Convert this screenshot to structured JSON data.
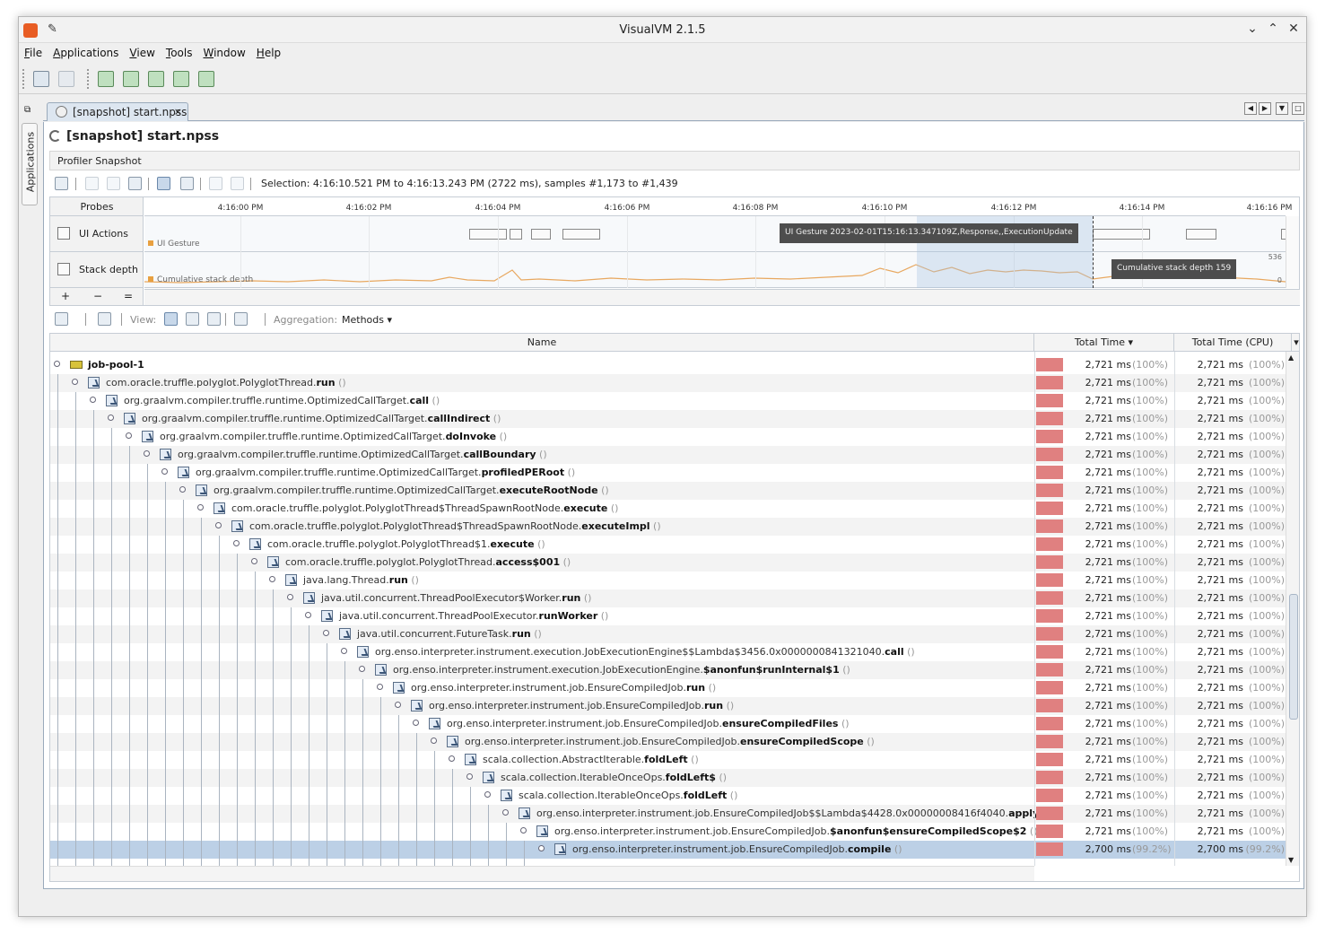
{
  "window": {
    "title": "VisualVM 2.1.5"
  },
  "menu": [
    "File",
    "Applications",
    "View",
    "Tools",
    "Window",
    "Help"
  ],
  "left_tab": "Applications",
  "doc_tab": {
    "label": "[snapshot] start.npss",
    "close": "×"
  },
  "panel": {
    "title": "[snapshot] start.npss",
    "subtab": "Profiler Snapshot"
  },
  "selection_text": "Selection: 4:16:10.521 PM to 4:16:13.243 PM (2722 ms), samples #1,173 to #1,439",
  "timeline": {
    "probes_header": "Probes",
    "rows": [
      "UI Actions",
      "Stack depth"
    ],
    "legend_ui": "UI Gesture",
    "legend_stack": "Cumulative stack depth",
    "ticks": [
      "4:16:00 PM",
      "4:16:02 PM",
      "4:16:04 PM",
      "4:16:06 PM",
      "4:16:08 PM",
      "4:16:10 PM",
      "4:16:12 PM",
      "4:16:14 PM",
      "4:16:16 PM"
    ],
    "tooltip_ui": "UI Gesture   2023-02-01T15:16:13.347109Z,Response,,ExecutionUpdate",
    "tooltip_stack": "Cumulative stack depth     159",
    "ymax": "536",
    "ymin": "0",
    "ctl": [
      "+",
      "−",
      "="
    ]
  },
  "view_toolbar": {
    "view_label": "View:",
    "aggregation_label": "Aggregation:",
    "aggregation_value": "Methods"
  },
  "columns": {
    "name": "Name",
    "total": "Total Time",
    "cpu": "Total Time (CPU)"
  },
  "rows": [
    {
      "kind": "thread",
      "pre": "",
      "bold": "job-pool-1",
      "post": "",
      "t": "2,721 ms",
      "tp": "(100%)",
      "c": "2,721 ms",
      "cp": "(100%)"
    },
    {
      "kind": "m",
      "pre": "com.oracle.truffle.polyglot.PolyglotThread.",
      "bold": "run",
      "post": " ()",
      "t": "2,721 ms",
      "tp": "(100%)",
      "c": "2,721 ms",
      "cp": "(100%)"
    },
    {
      "kind": "m",
      "pre": "org.graalvm.compiler.truffle.runtime.OptimizedCallTarget.",
      "bold": "call",
      "post": " ()",
      "t": "2,721 ms",
      "tp": "(100%)",
      "c": "2,721 ms",
      "cp": "(100%)"
    },
    {
      "kind": "m",
      "pre": "org.graalvm.compiler.truffle.runtime.OptimizedCallTarget.",
      "bold": "callIndirect",
      "post": " ()",
      "t": "2,721 ms",
      "tp": "(100%)",
      "c": "2,721 ms",
      "cp": "(100%)"
    },
    {
      "kind": "m",
      "pre": "org.graalvm.compiler.truffle.runtime.OptimizedCallTarget.",
      "bold": "doInvoke",
      "post": " ()",
      "t": "2,721 ms",
      "tp": "(100%)",
      "c": "2,721 ms",
      "cp": "(100%)"
    },
    {
      "kind": "m",
      "pre": "org.graalvm.compiler.truffle.runtime.OptimizedCallTarget.",
      "bold": "callBoundary",
      "post": " ()",
      "t": "2,721 ms",
      "tp": "(100%)",
      "c": "2,721 ms",
      "cp": "(100%)"
    },
    {
      "kind": "m",
      "pre": "org.graalvm.compiler.truffle.runtime.OptimizedCallTarget.",
      "bold": "profiledPERoot",
      "post": " ()",
      "t": "2,721 ms",
      "tp": "(100%)",
      "c": "2,721 ms",
      "cp": "(100%)"
    },
    {
      "kind": "m",
      "pre": "org.graalvm.compiler.truffle.runtime.OptimizedCallTarget.",
      "bold": "executeRootNode",
      "post": " ()",
      "t": "2,721 ms",
      "tp": "(100%)",
      "c": "2,721 ms",
      "cp": "(100%)"
    },
    {
      "kind": "m",
      "pre": "com.oracle.truffle.polyglot.PolyglotThread$ThreadSpawnRootNode.",
      "bold": "execute",
      "post": " ()",
      "t": "2,721 ms",
      "tp": "(100%)",
      "c": "2,721 ms",
      "cp": "(100%)"
    },
    {
      "kind": "m",
      "pre": "com.oracle.truffle.polyglot.PolyglotThread$ThreadSpawnRootNode.",
      "bold": "executeImpl",
      "post": " ()",
      "t": "2,721 ms",
      "tp": "(100%)",
      "c": "2,721 ms",
      "cp": "(100%)"
    },
    {
      "kind": "m",
      "pre": "com.oracle.truffle.polyglot.PolyglotThread$1.",
      "bold": "execute",
      "post": " ()",
      "t": "2,721 ms",
      "tp": "(100%)",
      "c": "2,721 ms",
      "cp": "(100%)"
    },
    {
      "kind": "m",
      "pre": "com.oracle.truffle.polyglot.PolyglotThread.",
      "bold": "access$001",
      "post": " ()",
      "t": "2,721 ms",
      "tp": "(100%)",
      "c": "2,721 ms",
      "cp": "(100%)"
    },
    {
      "kind": "m",
      "pre": "java.lang.Thread.",
      "bold": "run",
      "post": " ()",
      "t": "2,721 ms",
      "tp": "(100%)",
      "c": "2,721 ms",
      "cp": "(100%)"
    },
    {
      "kind": "m",
      "pre": "java.util.concurrent.ThreadPoolExecutor$Worker.",
      "bold": "run",
      "post": " ()",
      "t": "2,721 ms",
      "tp": "(100%)",
      "c": "2,721 ms",
      "cp": "(100%)"
    },
    {
      "kind": "m",
      "pre": "java.util.concurrent.ThreadPoolExecutor.",
      "bold": "runWorker",
      "post": " ()",
      "t": "2,721 ms",
      "tp": "(100%)",
      "c": "2,721 ms",
      "cp": "(100%)"
    },
    {
      "kind": "m",
      "pre": "java.util.concurrent.FutureTask.",
      "bold": "run",
      "post": " ()",
      "t": "2,721 ms",
      "tp": "(100%)",
      "c": "2,721 ms",
      "cp": "(100%)"
    },
    {
      "kind": "m",
      "pre": "org.enso.interpreter.instrument.execution.JobExecutionEngine$$Lambda$3456.0x0000000841321040.",
      "bold": "call",
      "post": " ()",
      "t": "2,721 ms",
      "tp": "(100%)",
      "c": "2,721 ms",
      "cp": "(100%)"
    },
    {
      "kind": "m",
      "pre": "org.enso.interpreter.instrument.execution.JobExecutionEngine.",
      "bold": "$anonfun$runInternal$1",
      "post": " ()",
      "t": "2,721 ms",
      "tp": "(100%)",
      "c": "2,721 ms",
      "cp": "(100%)"
    },
    {
      "kind": "m",
      "pre": "org.enso.interpreter.instrument.job.EnsureCompiledJob.",
      "bold": "run",
      "post": " ()",
      "t": "2,721 ms",
      "tp": "(100%)",
      "c": "2,721 ms",
      "cp": "(100%)"
    },
    {
      "kind": "m",
      "pre": "org.enso.interpreter.instrument.job.EnsureCompiledJob.",
      "bold": "run",
      "post": " ()",
      "t": "2,721 ms",
      "tp": "(100%)",
      "c": "2,721 ms",
      "cp": "(100%)"
    },
    {
      "kind": "m",
      "pre": "org.enso.interpreter.instrument.job.EnsureCompiledJob.",
      "bold": "ensureCompiledFiles",
      "post": " ()",
      "t": "2,721 ms",
      "tp": "(100%)",
      "c": "2,721 ms",
      "cp": "(100%)"
    },
    {
      "kind": "m",
      "pre": "org.enso.interpreter.instrument.job.EnsureCompiledJob.",
      "bold": "ensureCompiledScope",
      "post": " ()",
      "t": "2,721 ms",
      "tp": "(100%)",
      "c": "2,721 ms",
      "cp": "(100%)"
    },
    {
      "kind": "m",
      "pre": "scala.collection.AbstractIterable.",
      "bold": "foldLeft",
      "post": " ()",
      "t": "2,721 ms",
      "tp": "(100%)",
      "c": "2,721 ms",
      "cp": "(100%)"
    },
    {
      "kind": "m",
      "pre": "scala.collection.IterableOnceOps.",
      "bold": "foldLeft$",
      "post": " ()",
      "t": "2,721 ms",
      "tp": "(100%)",
      "c": "2,721 ms",
      "cp": "(100%)"
    },
    {
      "kind": "m",
      "pre": "scala.collection.IterableOnceOps.",
      "bold": "foldLeft",
      "post": " ()",
      "t": "2,721 ms",
      "tp": "(100%)",
      "c": "2,721 ms",
      "cp": "(100%)"
    },
    {
      "kind": "m",
      "pre": "org.enso.interpreter.instrument.job.EnsureCompiledJob$$Lambda$4428.0x00000008416f4040.",
      "bold": "apply",
      "post": " ()",
      "t": "2,721 ms",
      "tp": "(100%)",
      "c": "2,721 ms",
      "cp": "(100%)"
    },
    {
      "kind": "m",
      "pre": "org.enso.interpreter.instrument.job.EnsureCompiledJob.",
      "bold": "$anonfun$ensureCompiledScope$2",
      "post": " ()",
      "t": "2,721 ms",
      "tp": "(100%)",
      "c": "2,721 ms",
      "cp": "(100%)"
    },
    {
      "kind": "m",
      "pre": "org.enso.interpreter.instrument.job.EnsureCompiledJob.",
      "bold": "compile",
      "post": " ()",
      "t": "2,700 ms",
      "tp": "(99.2%)",
      "c": "2,700 ms",
      "cp": "(99.2%)",
      "selected": true
    }
  ]
}
